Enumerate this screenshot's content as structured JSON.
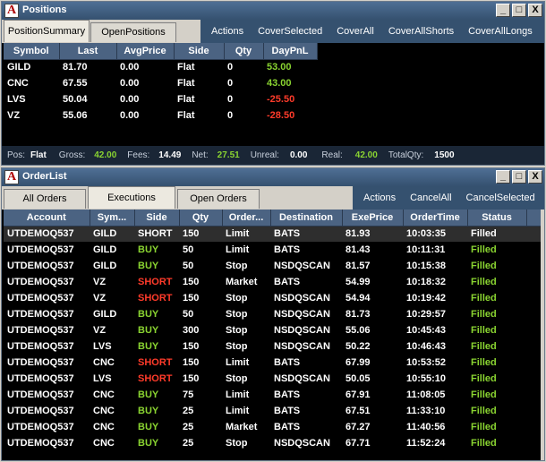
{
  "positions": {
    "title": "Positions",
    "tabs": [
      "PositionSummary",
      "OpenPositions"
    ],
    "actions": [
      "Actions",
      "CoverSelected",
      "CoverAll",
      "CoverAllShorts",
      "CoverAllLongs"
    ],
    "columns": [
      "Symbol",
      "Last",
      "AvgPrice",
      "Side",
      "Qty",
      "DayPnL"
    ],
    "rows": [
      {
        "symbol": "GILD",
        "last": "81.70",
        "avg": "0.00",
        "side": "Flat",
        "qty": "0",
        "pnl": "53.00",
        "pnl_color": "#8ad431"
      },
      {
        "symbol": "CNC",
        "last": "67.55",
        "avg": "0.00",
        "side": "Flat",
        "qty": "0",
        "pnl": "43.00",
        "pnl_color": "#8ad431"
      },
      {
        "symbol": "LVS",
        "last": "50.04",
        "avg": "0.00",
        "side": "Flat",
        "qty": "0",
        "pnl": "-25.50",
        "pnl_color": "#ff3b2a"
      },
      {
        "symbol": "VZ",
        "last": "55.06",
        "avg": "0.00",
        "side": "Flat",
        "qty": "0",
        "pnl": "-28.50",
        "pnl_color": "#ff3b2a"
      }
    ],
    "status": {
      "pos_label": "Pos:",
      "pos": "Flat",
      "gross_label": "Gross:",
      "gross": "42.00",
      "fees_label": "Fees:",
      "fees": "14.49",
      "net_label": "Net:",
      "net": "27.51",
      "unreal_label": "Unreal:",
      "unreal": "0.00",
      "real_label": "Real:",
      "real": "42.00",
      "totalqty_label": "TotalQty:",
      "totalqty": "1500"
    }
  },
  "orders": {
    "title": "OrderList",
    "tabs": [
      "All Orders",
      "Executions",
      "Open Orders"
    ],
    "actions": [
      "Actions",
      "CancelAll",
      "CancelSelected"
    ],
    "columns": [
      "Account",
      "Sym...",
      "Side",
      "Qty",
      "Order...",
      "Destination",
      "ExePrice",
      "OrderTime",
      "Status"
    ],
    "rows": [
      {
        "account": "UTDEMOQ537",
        "sym": "GILD",
        "side": "SHORT",
        "qty": "150",
        "type": "Limit",
        "dest": "BATS",
        "price": "81.93",
        "time": "10:03:35",
        "status": "Filled"
      },
      {
        "account": "UTDEMOQ537",
        "sym": "GILD",
        "side": "BUY",
        "qty": "50",
        "type": "Limit",
        "dest": "BATS",
        "price": "81.43",
        "time": "10:11:31",
        "status": "Filled"
      },
      {
        "account": "UTDEMOQ537",
        "sym": "GILD",
        "side": "BUY",
        "qty": "50",
        "type": "Stop",
        "dest": "NSDQSCAN",
        "price": "81.57",
        "time": "10:15:38",
        "status": "Filled"
      },
      {
        "account": "UTDEMOQ537",
        "sym": "VZ",
        "side": "SHORT",
        "qty": "150",
        "type": "Market",
        "dest": "BATS",
        "price": "54.99",
        "time": "10:18:32",
        "status": "Filled"
      },
      {
        "account": "UTDEMOQ537",
        "sym": "VZ",
        "side": "SHORT",
        "qty": "150",
        "type": "Stop",
        "dest": "NSDQSCAN",
        "price": "54.94",
        "time": "10:19:42",
        "status": "Filled"
      },
      {
        "account": "UTDEMOQ537",
        "sym": "GILD",
        "side": "BUY",
        "qty": "50",
        "type": "Stop",
        "dest": "NSDQSCAN",
        "price": "81.73",
        "time": "10:29:57",
        "status": "Filled"
      },
      {
        "account": "UTDEMOQ537",
        "sym": "VZ",
        "side": "BUY",
        "qty": "300",
        "type": "Stop",
        "dest": "NSDQSCAN",
        "price": "55.06",
        "time": "10:45:43",
        "status": "Filled"
      },
      {
        "account": "UTDEMOQ537",
        "sym": "LVS",
        "side": "BUY",
        "qty": "150",
        "type": "Stop",
        "dest": "NSDQSCAN",
        "price": "50.22",
        "time": "10:46:43",
        "status": "Filled"
      },
      {
        "account": "UTDEMOQ537",
        "sym": "CNC",
        "side": "SHORT",
        "qty": "150",
        "type": "Limit",
        "dest": "BATS",
        "price": "67.99",
        "time": "10:53:52",
        "status": "Filled"
      },
      {
        "account": "UTDEMOQ537",
        "sym": "LVS",
        "side": "SHORT",
        "qty": "150",
        "type": "Stop",
        "dest": "NSDQSCAN",
        "price": "50.05",
        "time": "10:55:10",
        "status": "Filled"
      },
      {
        "account": "UTDEMOQ537",
        "sym": "CNC",
        "side": "BUY",
        "qty": "75",
        "type": "Limit",
        "dest": "BATS",
        "price": "67.91",
        "time": "11:08:05",
        "status": "Filled"
      },
      {
        "account": "UTDEMOQ537",
        "sym": "CNC",
        "side": "BUY",
        "qty": "25",
        "type": "Limit",
        "dest": "BATS",
        "price": "67.51",
        "time": "11:33:10",
        "status": "Filled"
      },
      {
        "account": "UTDEMOQ537",
        "sym": "CNC",
        "side": "BUY",
        "qty": "25",
        "type": "Market",
        "dest": "BATS",
        "price": "67.27",
        "time": "11:40:56",
        "status": "Filled"
      },
      {
        "account": "UTDEMOQ537",
        "sym": "CNC",
        "side": "BUY",
        "qty": "25",
        "type": "Stop",
        "dest": "NSDQSCAN",
        "price": "67.71",
        "time": "11:52:24",
        "status": "Filled"
      }
    ]
  },
  "window_buttons": {
    "minimize": "_",
    "maximize": "□",
    "close": "X"
  },
  "app_icon_letter": "A",
  "colors": {
    "buy": "#8ad431",
    "short": "#ff3b2a",
    "filled": "#8ad431",
    "header": "#4b6382",
    "titlebar": "#35516f"
  }
}
